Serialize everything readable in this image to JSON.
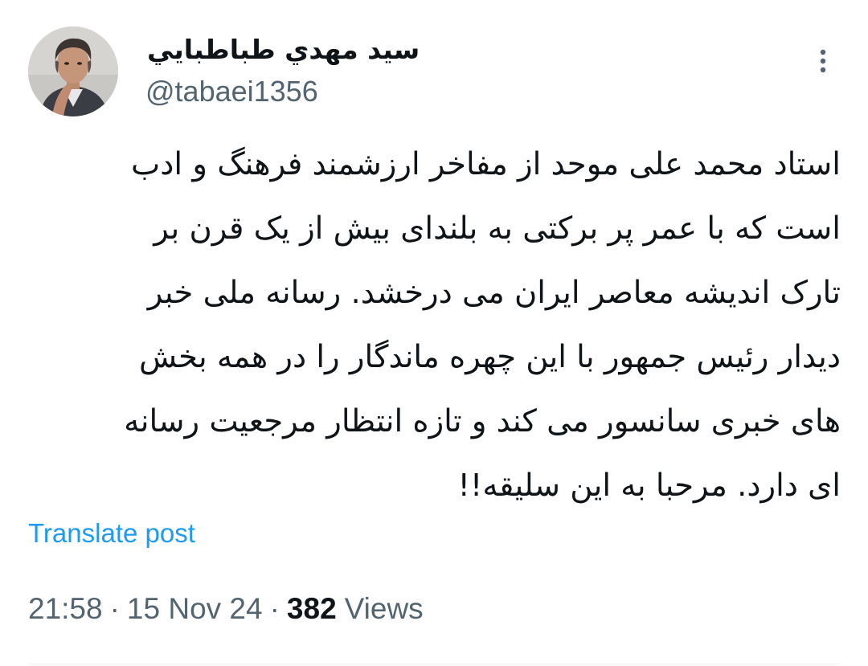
{
  "author": {
    "display_name": "سيد مهدي طباطبايي",
    "handle": "@tabaei1356",
    "avatar_icon": "profile-photo"
  },
  "more_icon": "three-dots-vertical-icon",
  "tweet": {
    "lines": [
      "استاد محمد علی موحد از مفاخر ارزشمند فرهنگ و ادب",
      "است که با عمر پر برکتی به بلندای بیش از یک قرن بر",
      "تارک اندیشه معاصر ایران می درخشد. رسانه ملی خبر",
      "دیدار رئیس جمهور با این چهره ماندگار را در همه بخش",
      "های خبری سانسور می کند و تازه انتظار مرجعیت رسانه",
      "ای دارد. مرحبا به این سلیقه!!"
    ]
  },
  "translate_label": "Translate post",
  "meta": {
    "time": "21:58",
    "separator": "·",
    "date": "15 Nov 24",
    "views_count": "382",
    "views_label": "Views"
  },
  "colors": {
    "link": "#1d9bf0",
    "secondary_text": "#536471",
    "primary_text": "#0f1419"
  }
}
